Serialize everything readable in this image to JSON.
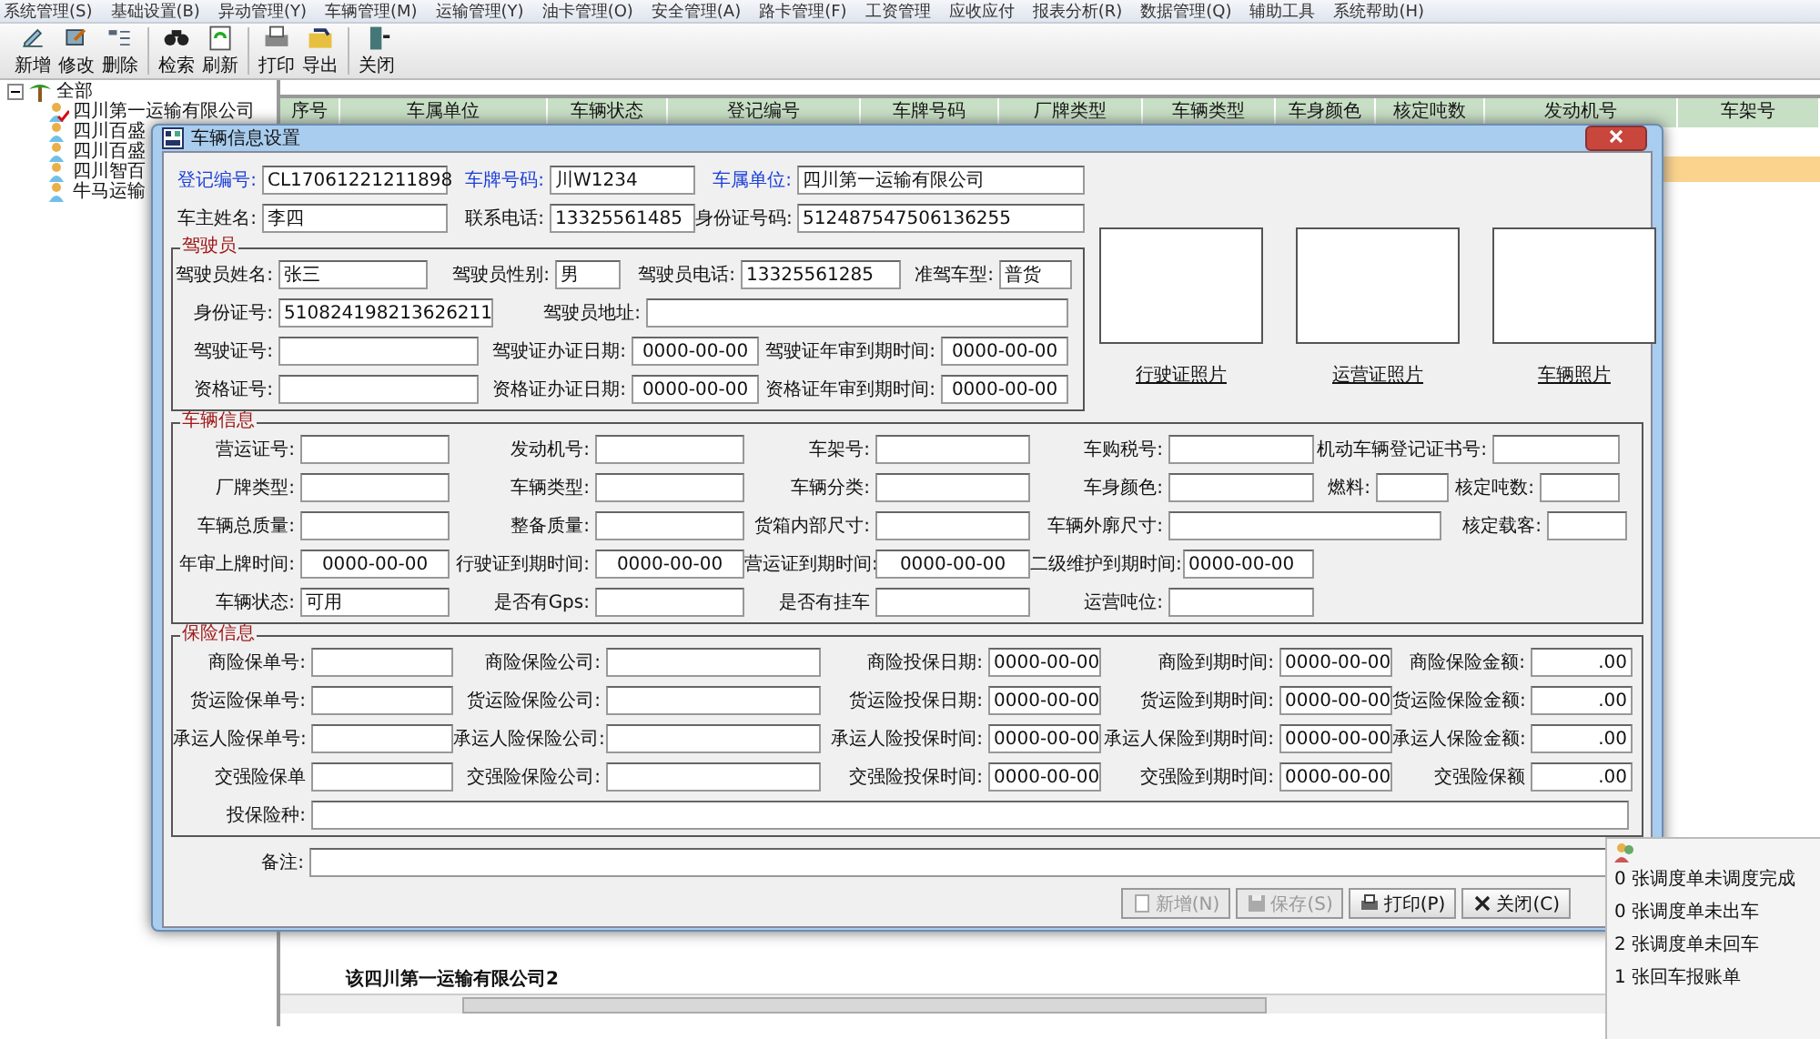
{
  "menu": [
    "系统管理(S)",
    "基础设置(B)",
    "异动管理(Y)",
    "车辆管理(M)",
    "运输管理(Y)",
    "油卡管理(O)",
    "安全管理(A)",
    "路卡管理(F)",
    "工资管理",
    "应收应付",
    "报表分析(R)",
    "数据管理(Q)",
    "辅助工具",
    "系统帮助(H)"
  ],
  "toolbar": [
    {
      "label": "新增",
      "kind": "add"
    },
    {
      "label": "修改",
      "kind": "edit"
    },
    {
      "label": "删除",
      "kind": "delete"
    },
    {
      "label": "检索",
      "kind": "search"
    },
    {
      "label": "刷新",
      "kind": "refresh"
    },
    {
      "label": "打印",
      "kind": "print"
    },
    {
      "label": "导出",
      "kind": "export"
    },
    {
      "label": "关闭",
      "kind": "close"
    }
  ],
  "tree": {
    "label": "全部",
    "expanded": true,
    "children": [
      {
        "label": "四川第一运输有限公司",
        "selected": true
      },
      {
        "label": "四川百盛",
        "selected": false
      },
      {
        "label": "四川百盛",
        "selected": false
      },
      {
        "label": "四川智百",
        "selected": false
      },
      {
        "label": "牛马运输",
        "selected": false
      }
    ]
  },
  "grid": {
    "columns": [
      "序号",
      "车属单位",
      "车辆状态",
      "登记编号",
      "车牌号码",
      "厂牌类型",
      "车辆类型",
      "车身颜色",
      "核定吨数",
      "发动机号",
      "车架号"
    ]
  },
  "below_text": "该四川第一运输有限公司2",
  "dialog": {
    "title": "车辆信息设置",
    "top_rows": [
      [
        {
          "label": "登记编号:",
          "value": "CL17061221211898",
          "kind": "key"
        },
        {
          "label": "车牌号码:",
          "value": "川W1234",
          "kind": "key"
        },
        {
          "label": "车属单位:",
          "value": "四川第一运输有限公司",
          "kind": "key"
        }
      ],
      [
        {
          "label": "车主姓名:",
          "value": "李四"
        },
        {
          "label": "联系电话:",
          "value": "13325561485"
        },
        {
          "label": "身份证号码:",
          "value": "512487547506136255"
        }
      ]
    ],
    "driver": {
      "title": "驾驶员",
      "rows": [
        [
          {
            "label": "驾驶员姓名:",
            "value": "张三"
          },
          {
            "label": "驾驶员性别:",
            "value": "男"
          },
          {
            "label": "驾驶员电话:",
            "value": "13325561285"
          },
          {
            "label": "准驾车型:",
            "value": "普货"
          }
        ],
        [
          {
            "label": "身份证号:",
            "value": "510824198213626211"
          },
          {
            "label": "驾驶员地址:"
          }
        ],
        [
          {
            "label": "驾驶证号:"
          },
          {
            "label": "驾驶证办证日期:",
            "value": "0000-00-00",
            "kind": "date"
          },
          {
            "label": "驾驶证年审到期时间:",
            "value": "0000-00-00",
            "kind": "date"
          }
        ],
        [
          {
            "label": "资格证号:"
          },
          {
            "label": "资格证办证日期:",
            "value": "0000-00-00",
            "kind": "date"
          },
          {
            "label": "资格证年审到期时间:",
            "value": "0000-00-00",
            "kind": "date"
          }
        ]
      ]
    },
    "photos": [
      "行驶证照片",
      "运营证照片",
      "车辆照片"
    ],
    "vehicle": {
      "title": "车辆信息",
      "rows": [
        [
          {
            "label": "营运证号:"
          },
          {
            "label": "发动机号:"
          },
          {
            "label": "车架号:"
          },
          {
            "label": "车购税号:"
          },
          {
            "label": "机动车辆登记证书号:"
          }
        ],
        [
          {
            "label": "厂牌类型:"
          },
          {
            "label": "车辆类型:"
          },
          {
            "label": "车辆分类:"
          },
          {
            "label": "车身颜色:"
          },
          {
            "label": "燃料:"
          },
          {
            "label": "核定吨数:"
          }
        ],
        [
          {
            "label": "车辆总质量:"
          },
          {
            "label": "整备质量:"
          },
          {
            "label": "货箱内部尺寸:"
          },
          {
            "label": "车辆外廓尺寸:"
          },
          {
            "label": "核定载客:"
          }
        ],
        [
          {
            "label": "年审上牌时间:",
            "value": "0000-00-00",
            "kind": "date"
          },
          {
            "label": "行驶证到期时间:",
            "value": "0000-00-00",
            "kind": "date"
          },
          {
            "label": "营运证到期时间:",
            "value": "0000-00-00",
            "kind": "date"
          },
          {
            "label": "二级维护到期时间:",
            "value": "0000-00-00"
          }
        ],
        [
          {
            "label": "车辆状态:",
            "value": "可用"
          },
          {
            "label": "是否有Gps:"
          },
          {
            "label": "是否有挂车"
          },
          {
            "label": "运营吨位:"
          }
        ]
      ]
    },
    "insurance": {
      "title": "保险信息",
      "rows": [
        [
          {
            "label": "商险保单号:"
          },
          {
            "label": "商险保险公司:"
          },
          {
            "label": "商险投保日期:",
            "value": "0000-00-00",
            "kind": "date"
          },
          {
            "label": "商险到期时间:",
            "value": "0000-00-00",
            "kind": "date"
          },
          {
            "label": "商险保险金额:",
            "value": ".00",
            "kind": "amount"
          }
        ],
        [
          {
            "label": "货运险保单号:"
          },
          {
            "label": "货运险保险公司:"
          },
          {
            "label": "货运险投保日期:",
            "value": "0000-00-00",
            "kind": "date"
          },
          {
            "label": "货运险到期时间:",
            "value": "0000-00-00",
            "kind": "date"
          },
          {
            "label": "货运险保险金额:",
            "value": ".00",
            "kind": "amount"
          }
        ],
        [
          {
            "label": "承运人险保单号:"
          },
          {
            "label": "承运人险保险公司:"
          },
          {
            "label": "承运人险投保时间:",
            "value": "0000-00-00",
            "kind": "date"
          },
          {
            "label": "承运人保险到期时间:",
            "value": "0000-00-00",
            "kind": "date"
          },
          {
            "label": "承运人保险金额:",
            "value": ".00",
            "kind": "amount"
          }
        ],
        [
          {
            "label": "交强险保单"
          },
          {
            "label": "交强险保险公司:"
          },
          {
            "label": "交强险投保时间:",
            "value": "0000-00-00",
            "kind": "date"
          },
          {
            "label": "交强险到期时间:",
            "value": "0000-00-00",
            "kind": "date"
          },
          {
            "label": "交强险保额",
            "value": ".00",
            "kind": "amount"
          }
        ],
        [
          {
            "label": "投保险种:"
          }
        ]
      ]
    },
    "remark": {
      "label": "备注:"
    },
    "buttons": [
      {
        "label": "新增(N)",
        "disabled": true,
        "kind": "add"
      },
      {
        "label": "保存(S)",
        "disabled": true,
        "kind": "save"
      },
      {
        "label": "打印(P)",
        "disabled": false,
        "kind": "print"
      },
      {
        "label": "关闭(C)",
        "disabled": false,
        "kind": "close"
      }
    ]
  },
  "reminders": [
    "0 张调度单未调度完成",
    "0 张调度单未出车",
    "2 张调度单未回车",
    "1 张回车报账单"
  ]
}
